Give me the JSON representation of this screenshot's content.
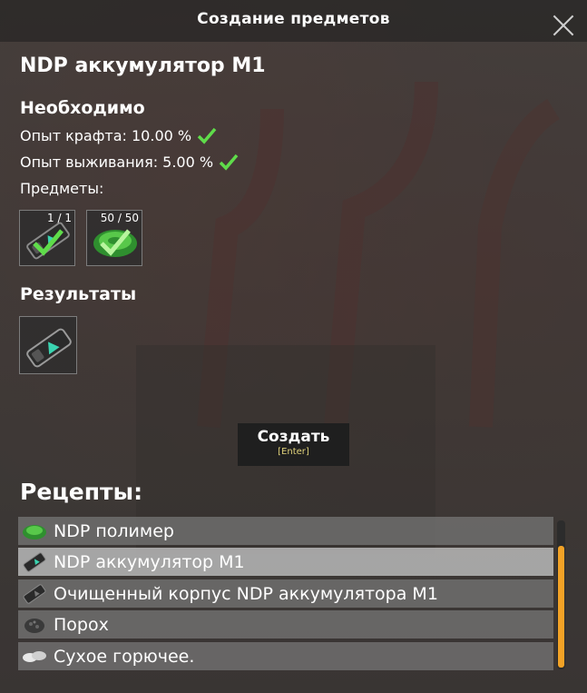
{
  "window": {
    "title": "Создание предметов"
  },
  "item": {
    "name": "NDP аккумулятор М1"
  },
  "requirements": {
    "heading": "Необходимо",
    "lines": [
      {
        "label": "Опыт крафта: 10.00 %"
      },
      {
        "label": "Опыт выживания: 5.00 %"
      }
    ],
    "items_label": "Предметы:",
    "slots": [
      {
        "count": "1 / 1",
        "icon": "battery-icon"
      },
      {
        "count": "50 / 50",
        "icon": "polymer-icon"
      }
    ]
  },
  "results": {
    "heading": "Результаты",
    "icon": "battery-icon"
  },
  "create_button": {
    "label": "Создать",
    "hint": "[Enter]"
  },
  "recipes": {
    "heading": "Рецепты:",
    "items": [
      {
        "label": "NDP полимер",
        "icon": "polymer-icon"
      },
      {
        "label": "NDP аккумулятор М1",
        "icon": "battery-icon",
        "selected": true
      },
      {
        "label": "Очищенный корпус NDP аккумулятора М1",
        "icon": "battery-case-icon"
      },
      {
        "label": "Порох",
        "icon": "gunpowder-icon"
      },
      {
        "label": "Сухое горючее.",
        "icon": "dry-fuel-icon"
      }
    ]
  },
  "colors": {
    "check": "#5fdc4a",
    "scroll_thumb": "#f2a226",
    "hint": "#e0d27a"
  }
}
